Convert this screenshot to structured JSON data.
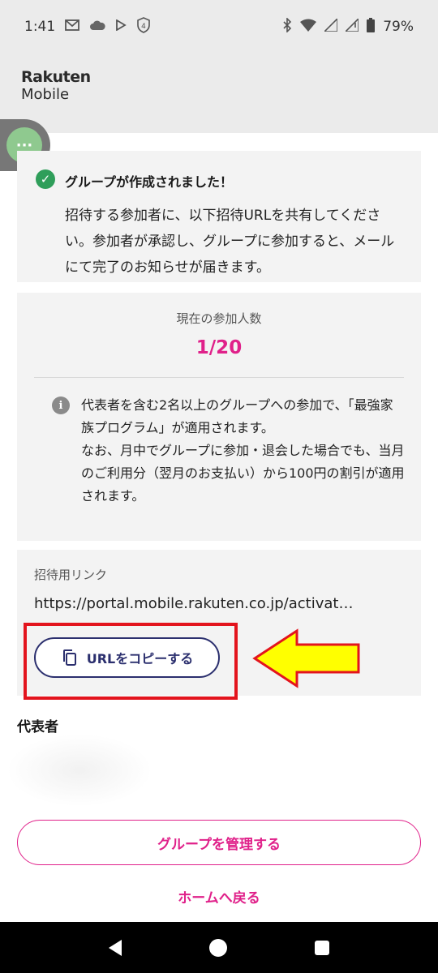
{
  "status_bar": {
    "time": "1:41",
    "battery": "79%",
    "left_icons": [
      "mail-icon",
      "cloud-icon",
      "play-icon",
      "shield-icon"
    ],
    "shield_badge": "4",
    "right_icons": [
      "bluetooth-icon",
      "wifi-icon",
      "signal-icon",
      "signal-icon",
      "battery-icon"
    ]
  },
  "header": {
    "logo_line1": "Rakuten",
    "logo_line2": "Mobile"
  },
  "floating_bubble": {
    "icon": "more-dots-icon",
    "glyph": "···"
  },
  "success": {
    "title": "グループが作成されました！",
    "body": "招待する参加者に、以下招待URLを共有してください。参加者が承認し、グループに参加すると、メールにて完了のお知らせが届きます。"
  },
  "members": {
    "label": "現在の参加人数",
    "value": "1/20"
  },
  "info": {
    "line1": "代表者を含む2名以上のグループへの参加で、「最強家族プログラム」が適用されます。",
    "line2": "なお、月中でグループに参加・退会した場合でも、当月のご利用分（翌月のお支払い）から100円の割引が適用されます。"
  },
  "invite": {
    "label": "招待用リンク",
    "url": "https://portal.mobile.rakuten.co.jp/activat…",
    "copy_button": "URLをコピーする"
  },
  "representative": {
    "title": "代表者"
  },
  "actions": {
    "manage": "グループを管理する",
    "home": "ホームへ戻る"
  },
  "colors": {
    "brand_pink": "#e0218a",
    "button_navy": "#2b2f6e",
    "highlight_red": "#e3141d",
    "arrow_yellow": "#ffff00",
    "success_green": "#2f9e5a"
  }
}
